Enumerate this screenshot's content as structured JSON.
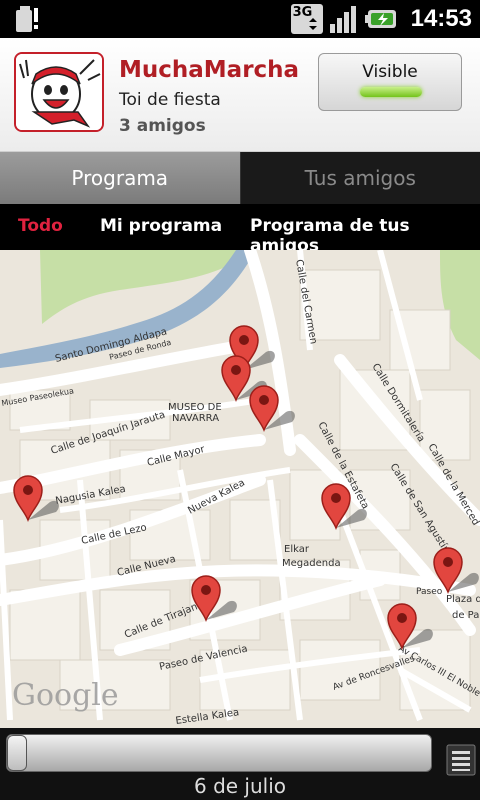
{
  "statusbar": {
    "network": "3G",
    "time": "14:53"
  },
  "header": {
    "app_name": "MuchaMarcha",
    "subtitle": "Toi de fiesta",
    "friends": "3 amigos",
    "visible_label": "Visible"
  },
  "tabs": [
    {
      "label": "Programa",
      "active": true
    },
    {
      "label": "Tus amigos",
      "active": false
    }
  ],
  "subtabs": [
    {
      "label": "Todo",
      "active": true
    },
    {
      "label": "Mi programa",
      "active": false
    },
    {
      "label": "Programa de tus amigos",
      "active": false
    }
  ],
  "map": {
    "streets": [
      "Calle del Carmen",
      "Santo Domingo Aldapa",
      "Paseo de Ronda",
      "Calle Dormitalería",
      "Museo Paseolekua",
      "Calle de Joaquín Jarauta",
      "MUSEO DE",
      "NAVARRA",
      "Calle Mayor",
      "Nagusia Kalea",
      "Calle de la Estafeta",
      "Calle de San Agustín",
      "Calle de la Merced",
      "Calle de Lezo",
      "Nueva Kalea",
      "Calle Nueva",
      "Elkar",
      "Megadenda",
      "Paseo",
      "Plaza de",
      "de Par",
      "Calle de Tirajana",
      "Paseo de Valencia",
      "Av de Roncesvalles",
      "Av Carlos III El Noble",
      "Estella Kalea"
    ],
    "logo": "Google",
    "pins": 8
  },
  "slider": {
    "value": 0.0
  },
  "date": "6 de julio"
}
